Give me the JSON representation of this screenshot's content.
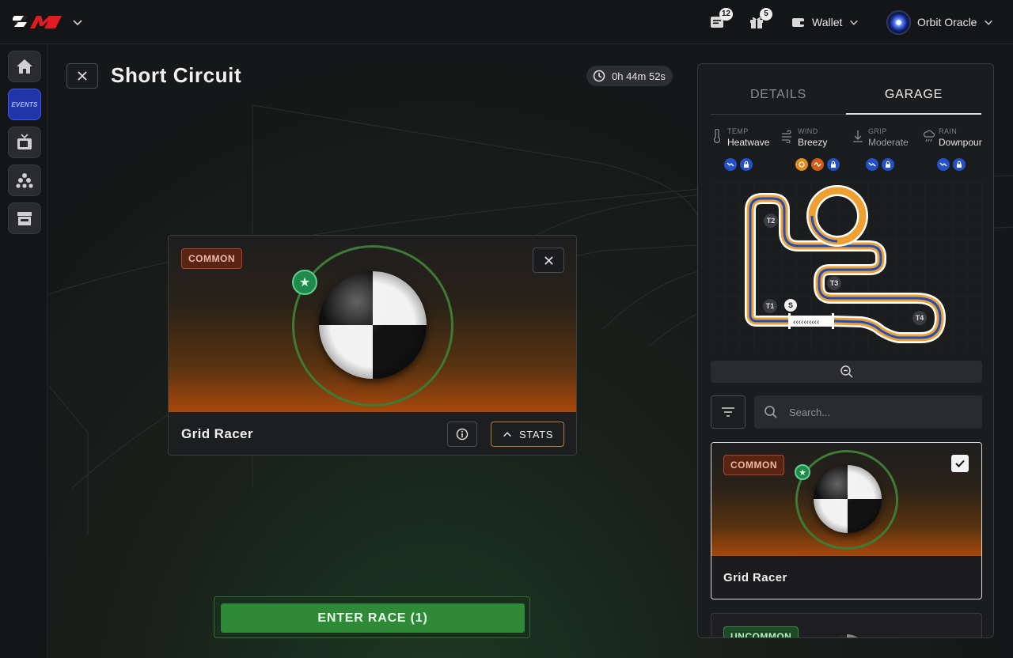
{
  "header": {
    "notifications_count": "12",
    "gifts_count": "5",
    "wallet_label": "Wallet",
    "user_name": "Orbit Oracle"
  },
  "sidebar": {
    "items": [
      {
        "name": "home",
        "label": ""
      },
      {
        "name": "events",
        "label": "EVENTS"
      },
      {
        "name": "tv",
        "label": ""
      },
      {
        "name": "community",
        "label": ""
      },
      {
        "name": "shop",
        "label": ""
      }
    ]
  },
  "race": {
    "title": "Short Circuit",
    "timer": "0h 44m 52s"
  },
  "selected_card": {
    "rarity": "COMMON",
    "name": "Grid Racer",
    "stats_label": "STATS"
  },
  "enter_race_label": "ENTER RACE (1)",
  "panel": {
    "tabs": [
      "DETAILS",
      "GARAGE"
    ],
    "active_tab": "GARAGE",
    "conditions": [
      {
        "label": "TEMP",
        "value": "Heatwave"
      },
      {
        "label": "WIND",
        "value": "Breezy"
      },
      {
        "label": "GRIP",
        "value": "Moderate"
      },
      {
        "label": "RAIN",
        "value": "Downpour"
      }
    ],
    "track_markers": [
      "T1",
      "T2",
      "T3",
      "T4",
      "S"
    ],
    "search_placeholder": "Search...",
    "garage_cards": [
      {
        "rarity": "COMMON",
        "name": "Grid Racer",
        "selected": true
      },
      {
        "rarity": "UNCOMMON",
        "name": "",
        "selected": false
      }
    ]
  },
  "colors": {
    "accent_green": "#2e8a36",
    "common": "#b0452a",
    "uncommon": "#3a8a45",
    "track_orange": "#f0a030",
    "track_blue": "#1e4fbf"
  }
}
